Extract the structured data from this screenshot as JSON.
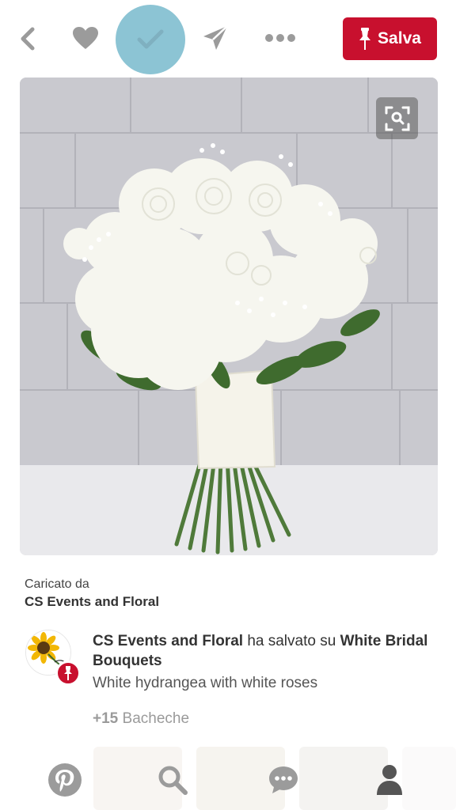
{
  "toolbar": {
    "back_icon": "chevron-left-icon",
    "like_icon": "heart-icon",
    "done_icon": "check-icon",
    "send_icon": "paper-plane-icon",
    "more_icon": "more-dots-icon",
    "save_label": "Salva",
    "save_icon": "pin-icon",
    "accent_color": "#c8102e",
    "check_circle_color": "#8cc4d4"
  },
  "pin": {
    "image_subject": "white hydrangea and rose bridal bouquet",
    "visual_search_icon": "visual-search-lens-icon"
  },
  "uploader": {
    "label": "Caricato da",
    "name": "CS Events and Floral"
  },
  "saver": {
    "name": "CS Events and Floral",
    "action": "ha salvato su",
    "board": "White Bridal Bouquets",
    "description": "White hydrangea with white roses",
    "boards_count": "+15",
    "boards_label": "Bacheche"
  },
  "bottom_nav": {
    "items": [
      {
        "icon": "pinterest-logo-icon"
      },
      {
        "icon": "search-icon"
      },
      {
        "icon": "speech-bubble-icon"
      },
      {
        "icon": "profile-icon"
      }
    ]
  }
}
